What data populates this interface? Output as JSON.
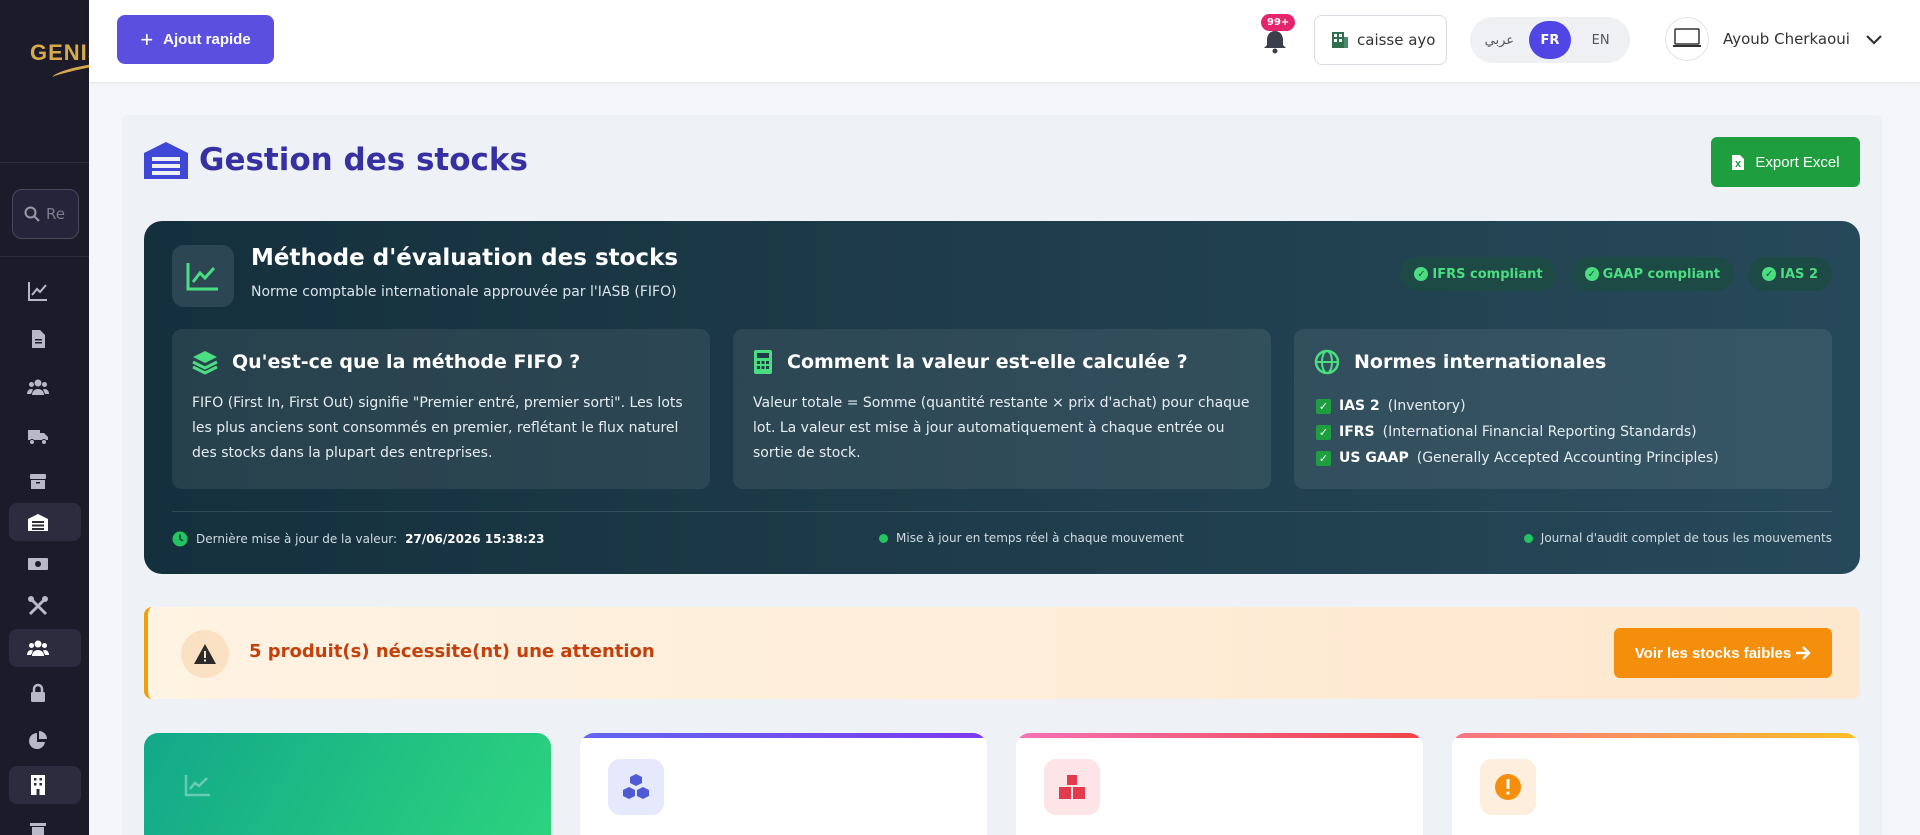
{
  "sidebar": {
    "logo_text": "GENIS",
    "search_placeholder": "Re",
    "items": [
      {
        "icon": "chart-line-icon",
        "active": false
      },
      {
        "icon": "document-icon",
        "active": false
      },
      {
        "icon": "users-icon",
        "active": false
      },
      {
        "icon": "truck-icon",
        "active": false
      },
      {
        "icon": "box-icon",
        "active": false
      },
      {
        "icon": "warehouse-icon",
        "active": true
      },
      {
        "icon": "money-icon",
        "active": false
      },
      {
        "icon": "tools-icon",
        "active": false
      },
      {
        "icon": "user-group-icon",
        "active": true
      },
      {
        "icon": "lock-icon",
        "active": false
      },
      {
        "icon": "pie-chart-icon",
        "active": false
      },
      {
        "icon": "building-icon",
        "active": true
      },
      {
        "icon": "trash-icon",
        "active": false
      }
    ]
  },
  "topbar": {
    "quick_add_label": "Ajout rapide",
    "notification_count": "99+",
    "caisse_label": "caisse ayo",
    "languages": [
      {
        "label": "عربي",
        "active": false
      },
      {
        "label": "FR",
        "active": true
      },
      {
        "label": "EN",
        "active": false
      }
    ],
    "user_name": "Ayoub Cherkaoui"
  },
  "page": {
    "title": "Gestion des stocks",
    "export_label": "Export Excel"
  },
  "evaluation": {
    "title": "Méthode d'évaluation des stocks",
    "subtitle": "Norme comptable internationale approuvée par l'IASB (FIFO)",
    "badges": [
      "IFRS compliant",
      "GAAP compliant",
      "IAS 2"
    ],
    "fifo": {
      "title": "Qu'est-ce que la méthode FIFO ?",
      "text": "FIFO (First In, First Out) signifie \"Premier entré, premier sorti\". Les lots les plus anciens sont consommés en premier, reflétant le flux naturel des stocks dans la plupart des entreprises."
    },
    "calc": {
      "title": "Comment la valeur est-elle calculée ?",
      "text": "Valeur totale = Somme (quantité restante × prix d'achat) pour chaque lot. La valeur est mise à jour automatiquement à chaque entrée ou sortie de stock."
    },
    "norms": {
      "title": "Normes internationales",
      "items": [
        {
          "code": "IAS 2",
          "desc": "(Inventory)"
        },
        {
          "code": "IFRS",
          "desc": "(International Financial Reporting Standards)"
        },
        {
          "code": "US GAAP",
          "desc": "(Generally Accepted Accounting Principles)"
        }
      ]
    },
    "footer": {
      "last_update_label": "Dernière mise à jour de la valeur:",
      "last_update_value": "27/06/2026 15:38:23",
      "realtime": "Mise à jour en temps réel à chaque mouvement",
      "audit": "Journal d'audit complet de tous les mouvements"
    }
  },
  "alert": {
    "text": "5 produit(s) nécessite(nt) une attention",
    "button": "Voir les stocks faibles"
  },
  "colors": {
    "primary": "#5b4fe0",
    "title": "#3730a3",
    "success": "#1e9e3e",
    "warning": "#f58e0b"
  }
}
